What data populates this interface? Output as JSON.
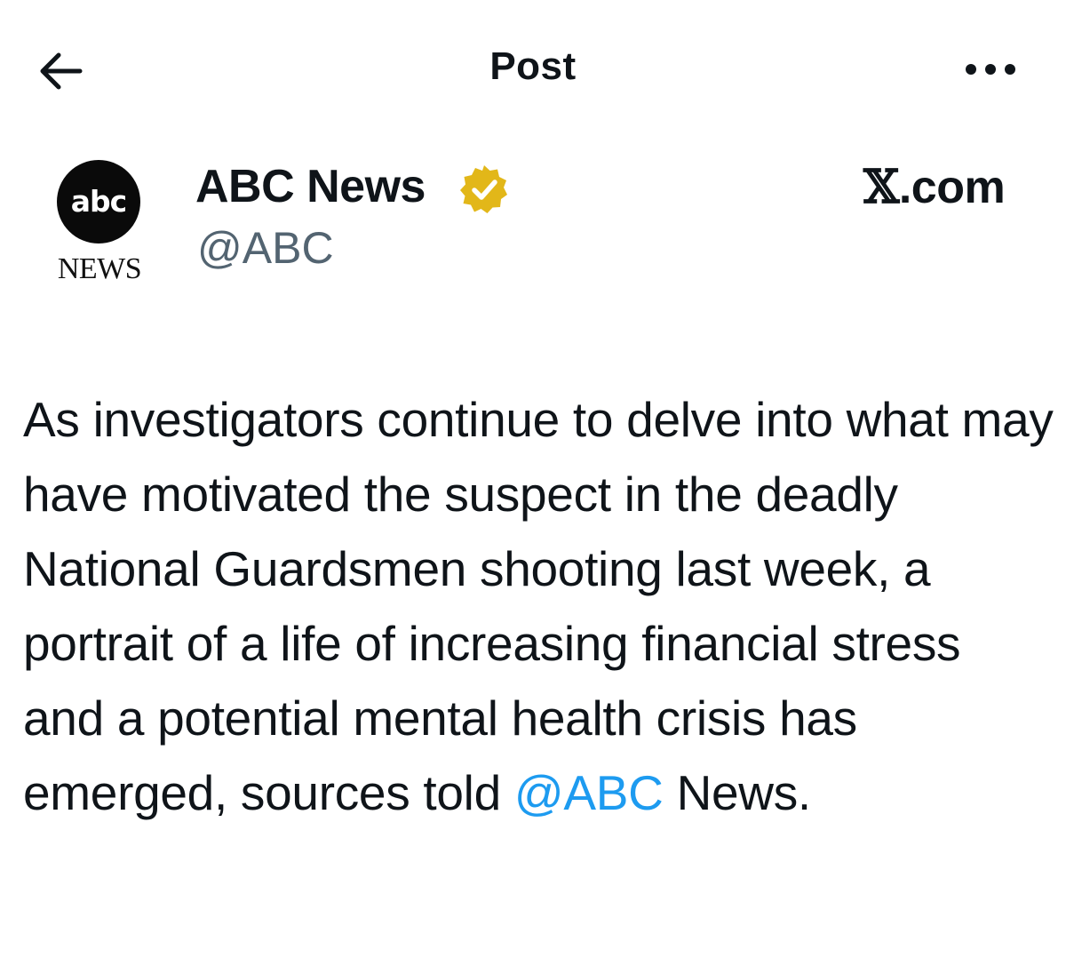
{
  "header": {
    "title": "Post",
    "back_icon": "arrow-left-icon",
    "more_icon": "more-horizontal-icon"
  },
  "author": {
    "avatar_logo_text": "abc",
    "avatar_caption": "NEWS",
    "name": "ABC News",
    "handle": "@ABC",
    "verified_badge_color": "#e2b719",
    "verified_icon": "gold-verified-badge-icon"
  },
  "source": {
    "x_symbol": "𝕏",
    "domain": ".com"
  },
  "post": {
    "text_before_mention": "As investigators continue to delve into what may have motivated the suspect in the deadly National Guardsmen shooting last week, a portrait of a life of increasing financial stress and a potential mental health crisis has emerged, sources told ",
    "mention": "@ABC",
    "text_after_mention": " News."
  },
  "colors": {
    "text": "#0f1419",
    "secondary_text": "#536471",
    "link": "#1d9bf0"
  }
}
